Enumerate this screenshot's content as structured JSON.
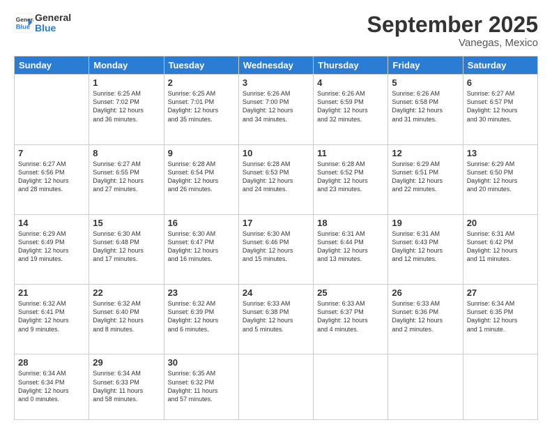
{
  "header": {
    "logo_line1": "General",
    "logo_line2": "Blue",
    "month": "September 2025",
    "location": "Vanegas, Mexico"
  },
  "days_of_week": [
    "Sunday",
    "Monday",
    "Tuesday",
    "Wednesday",
    "Thursday",
    "Friday",
    "Saturday"
  ],
  "weeks": [
    [
      {
        "day": "",
        "info": ""
      },
      {
        "day": "1",
        "info": "Sunrise: 6:25 AM\nSunset: 7:02 PM\nDaylight: 12 hours\nand 36 minutes."
      },
      {
        "day": "2",
        "info": "Sunrise: 6:25 AM\nSunset: 7:01 PM\nDaylight: 12 hours\nand 35 minutes."
      },
      {
        "day": "3",
        "info": "Sunrise: 6:26 AM\nSunset: 7:00 PM\nDaylight: 12 hours\nand 34 minutes."
      },
      {
        "day": "4",
        "info": "Sunrise: 6:26 AM\nSunset: 6:59 PM\nDaylight: 12 hours\nand 32 minutes."
      },
      {
        "day": "5",
        "info": "Sunrise: 6:26 AM\nSunset: 6:58 PM\nDaylight: 12 hours\nand 31 minutes."
      },
      {
        "day": "6",
        "info": "Sunrise: 6:27 AM\nSunset: 6:57 PM\nDaylight: 12 hours\nand 30 minutes."
      }
    ],
    [
      {
        "day": "7",
        "info": "Sunrise: 6:27 AM\nSunset: 6:56 PM\nDaylight: 12 hours\nand 28 minutes."
      },
      {
        "day": "8",
        "info": "Sunrise: 6:27 AM\nSunset: 6:55 PM\nDaylight: 12 hours\nand 27 minutes."
      },
      {
        "day": "9",
        "info": "Sunrise: 6:28 AM\nSunset: 6:54 PM\nDaylight: 12 hours\nand 26 minutes."
      },
      {
        "day": "10",
        "info": "Sunrise: 6:28 AM\nSunset: 6:53 PM\nDaylight: 12 hours\nand 24 minutes."
      },
      {
        "day": "11",
        "info": "Sunrise: 6:28 AM\nSunset: 6:52 PM\nDaylight: 12 hours\nand 23 minutes."
      },
      {
        "day": "12",
        "info": "Sunrise: 6:29 AM\nSunset: 6:51 PM\nDaylight: 12 hours\nand 22 minutes."
      },
      {
        "day": "13",
        "info": "Sunrise: 6:29 AM\nSunset: 6:50 PM\nDaylight: 12 hours\nand 20 minutes."
      }
    ],
    [
      {
        "day": "14",
        "info": "Sunrise: 6:29 AM\nSunset: 6:49 PM\nDaylight: 12 hours\nand 19 minutes."
      },
      {
        "day": "15",
        "info": "Sunrise: 6:30 AM\nSunset: 6:48 PM\nDaylight: 12 hours\nand 17 minutes."
      },
      {
        "day": "16",
        "info": "Sunrise: 6:30 AM\nSunset: 6:47 PM\nDaylight: 12 hours\nand 16 minutes."
      },
      {
        "day": "17",
        "info": "Sunrise: 6:30 AM\nSunset: 6:46 PM\nDaylight: 12 hours\nand 15 minutes."
      },
      {
        "day": "18",
        "info": "Sunrise: 6:31 AM\nSunset: 6:44 PM\nDaylight: 12 hours\nand 13 minutes."
      },
      {
        "day": "19",
        "info": "Sunrise: 6:31 AM\nSunset: 6:43 PM\nDaylight: 12 hours\nand 12 minutes."
      },
      {
        "day": "20",
        "info": "Sunrise: 6:31 AM\nSunset: 6:42 PM\nDaylight: 12 hours\nand 11 minutes."
      }
    ],
    [
      {
        "day": "21",
        "info": "Sunrise: 6:32 AM\nSunset: 6:41 PM\nDaylight: 12 hours\nand 9 minutes."
      },
      {
        "day": "22",
        "info": "Sunrise: 6:32 AM\nSunset: 6:40 PM\nDaylight: 12 hours\nand 8 minutes."
      },
      {
        "day": "23",
        "info": "Sunrise: 6:32 AM\nSunset: 6:39 PM\nDaylight: 12 hours\nand 6 minutes."
      },
      {
        "day": "24",
        "info": "Sunrise: 6:33 AM\nSunset: 6:38 PM\nDaylight: 12 hours\nand 5 minutes."
      },
      {
        "day": "25",
        "info": "Sunrise: 6:33 AM\nSunset: 6:37 PM\nDaylight: 12 hours\nand 4 minutes."
      },
      {
        "day": "26",
        "info": "Sunrise: 6:33 AM\nSunset: 6:36 PM\nDaylight: 12 hours\nand 2 minutes."
      },
      {
        "day": "27",
        "info": "Sunrise: 6:34 AM\nSunset: 6:35 PM\nDaylight: 12 hours\nand 1 minute."
      }
    ],
    [
      {
        "day": "28",
        "info": "Sunrise: 6:34 AM\nSunset: 6:34 PM\nDaylight: 12 hours\nand 0 minutes."
      },
      {
        "day": "29",
        "info": "Sunrise: 6:34 AM\nSunset: 6:33 PM\nDaylight: 11 hours\nand 58 minutes."
      },
      {
        "day": "30",
        "info": "Sunrise: 6:35 AM\nSunset: 6:32 PM\nDaylight: 11 hours\nand 57 minutes."
      },
      {
        "day": "",
        "info": ""
      },
      {
        "day": "",
        "info": ""
      },
      {
        "day": "",
        "info": ""
      },
      {
        "day": "",
        "info": ""
      }
    ]
  ]
}
